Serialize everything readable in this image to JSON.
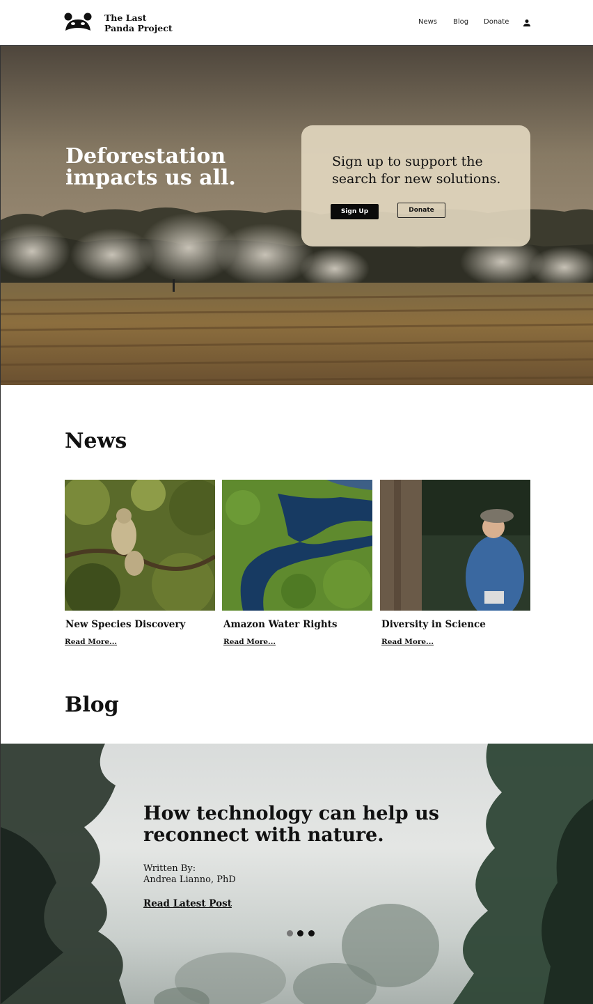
{
  "header": {
    "logo_line1": "The Last",
    "logo_line2": "Panda Project",
    "nav": {
      "news": "News",
      "blog": "Blog",
      "donate": "Donate"
    },
    "user_icon": "user-icon"
  },
  "hero": {
    "title": "Deforestation impacts us all.",
    "card_text": "Sign up to support the search for new solutions.",
    "signup_label": "Sign Up",
    "donate_label": "Donate"
  },
  "news": {
    "heading": "News",
    "items": [
      {
        "title": "New Species Discovery",
        "link": "Read More..."
      },
      {
        "title": "Amazon Water Rights",
        "link": "Read More..."
      },
      {
        "title": "Diversity in Science",
        "link": "Read More..."
      }
    ]
  },
  "blog": {
    "heading": "Blog",
    "title": "How technology can help us reconnect with nature.",
    "byline_label": "Written By:",
    "author": "Andrea Lianno, PhD",
    "link": "Read Latest Post",
    "carousel_active_index": 0,
    "carousel_count": 3
  },
  "colors": {
    "accent": "#0a0a0a",
    "card_bg": "#e1d6be",
    "text": "#111111"
  }
}
